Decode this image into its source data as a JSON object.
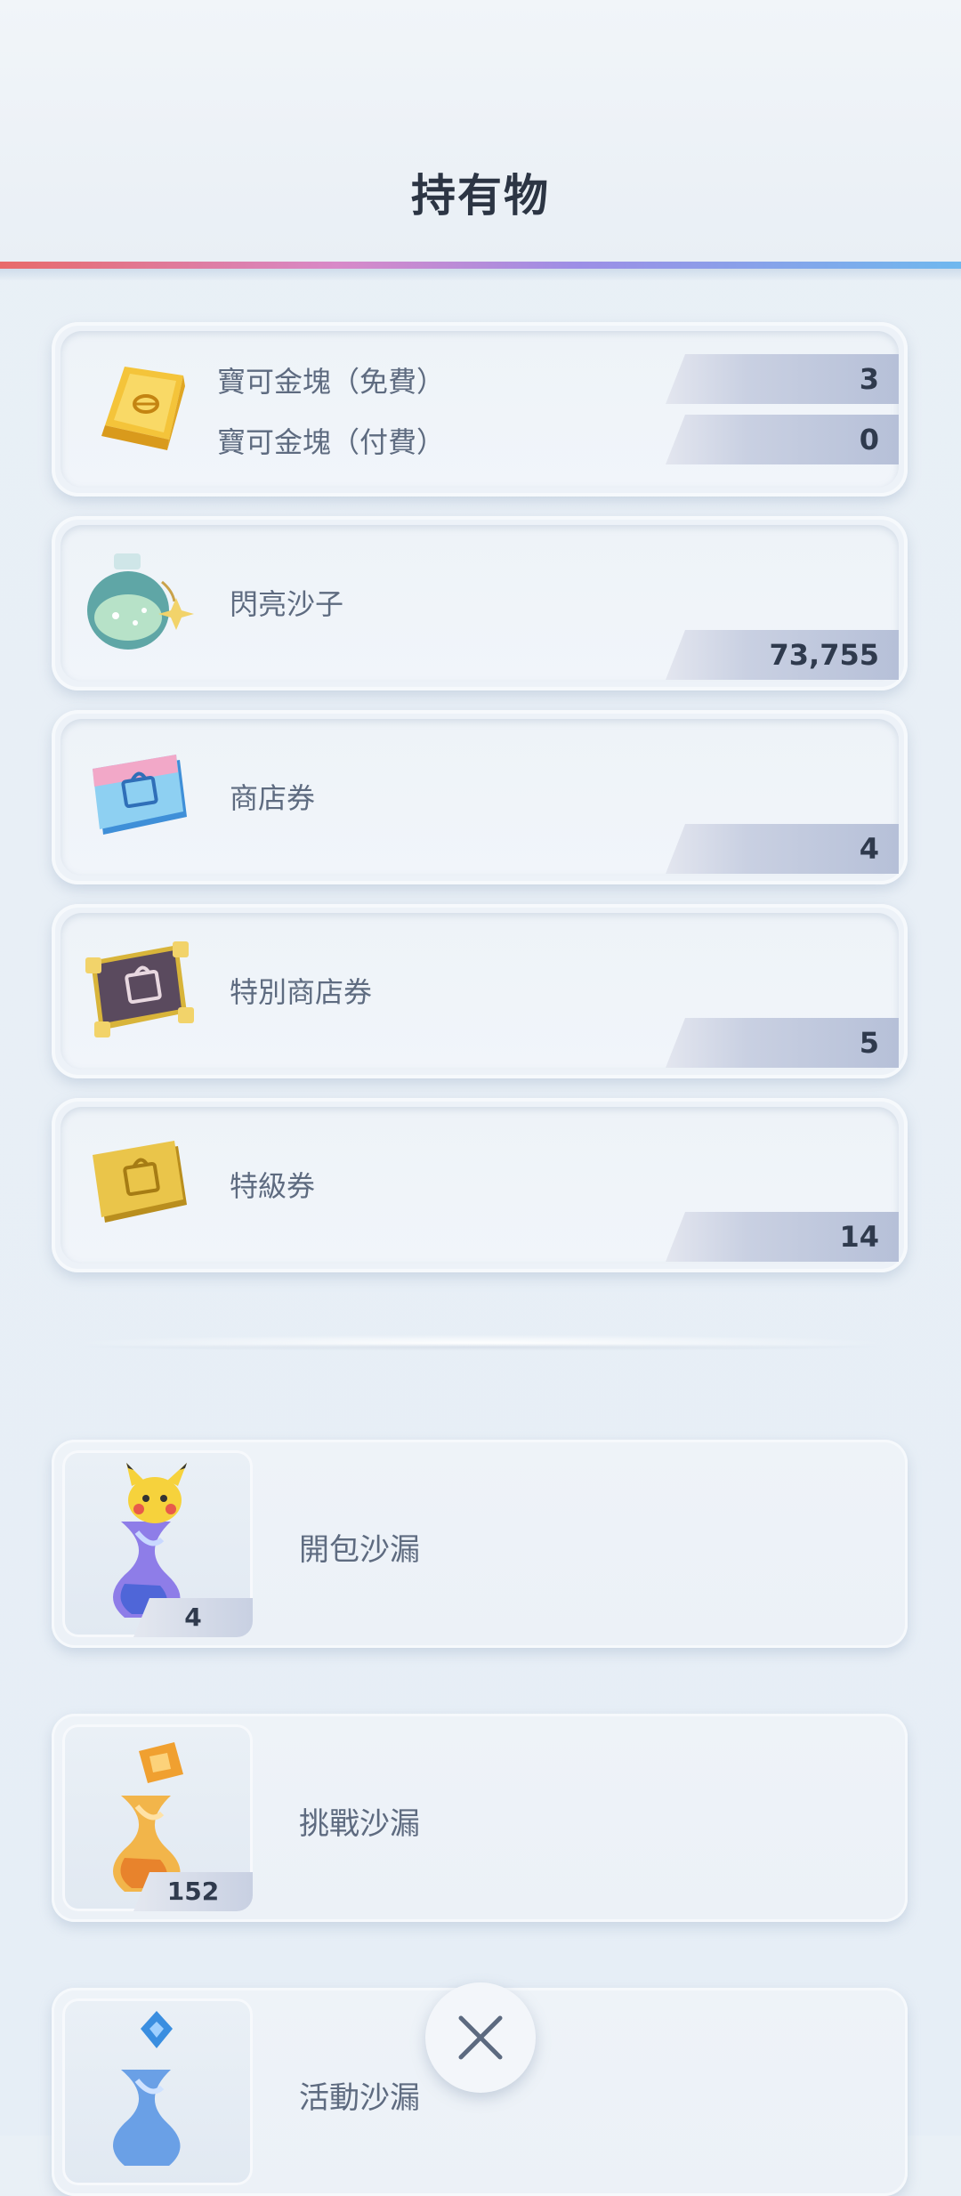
{
  "header": {
    "title": "持有物"
  },
  "items": {
    "gold_free": {
      "label": "寶可金塊（免費）",
      "value": "3"
    },
    "gold_paid": {
      "label": "寶可金塊（付費）",
      "value": "0"
    },
    "shinedust": {
      "label": "閃亮沙子",
      "value": "73,755"
    },
    "shop_ticket": {
      "label": "商店券",
      "value": "4"
    },
    "special_shop_ticket": {
      "label": "特別商店券",
      "value": "5"
    },
    "premium_ticket": {
      "label": "特級券",
      "value": "14"
    }
  },
  "hourglasses": [
    {
      "label": "開包沙漏",
      "count": "4"
    },
    {
      "label": "挑戰沙漏",
      "count": "152"
    },
    {
      "label": "活動沙漏",
      "count": ""
    }
  ],
  "icons": {
    "gold": "gold-bar-icon",
    "shinedust": "shinedust-bottle-icon",
    "shop_ticket": "shop-ticket-icon",
    "special_shop_ticket": "special-shop-ticket-icon",
    "premium_ticket": "premium-ticket-icon",
    "close": "close-icon"
  }
}
